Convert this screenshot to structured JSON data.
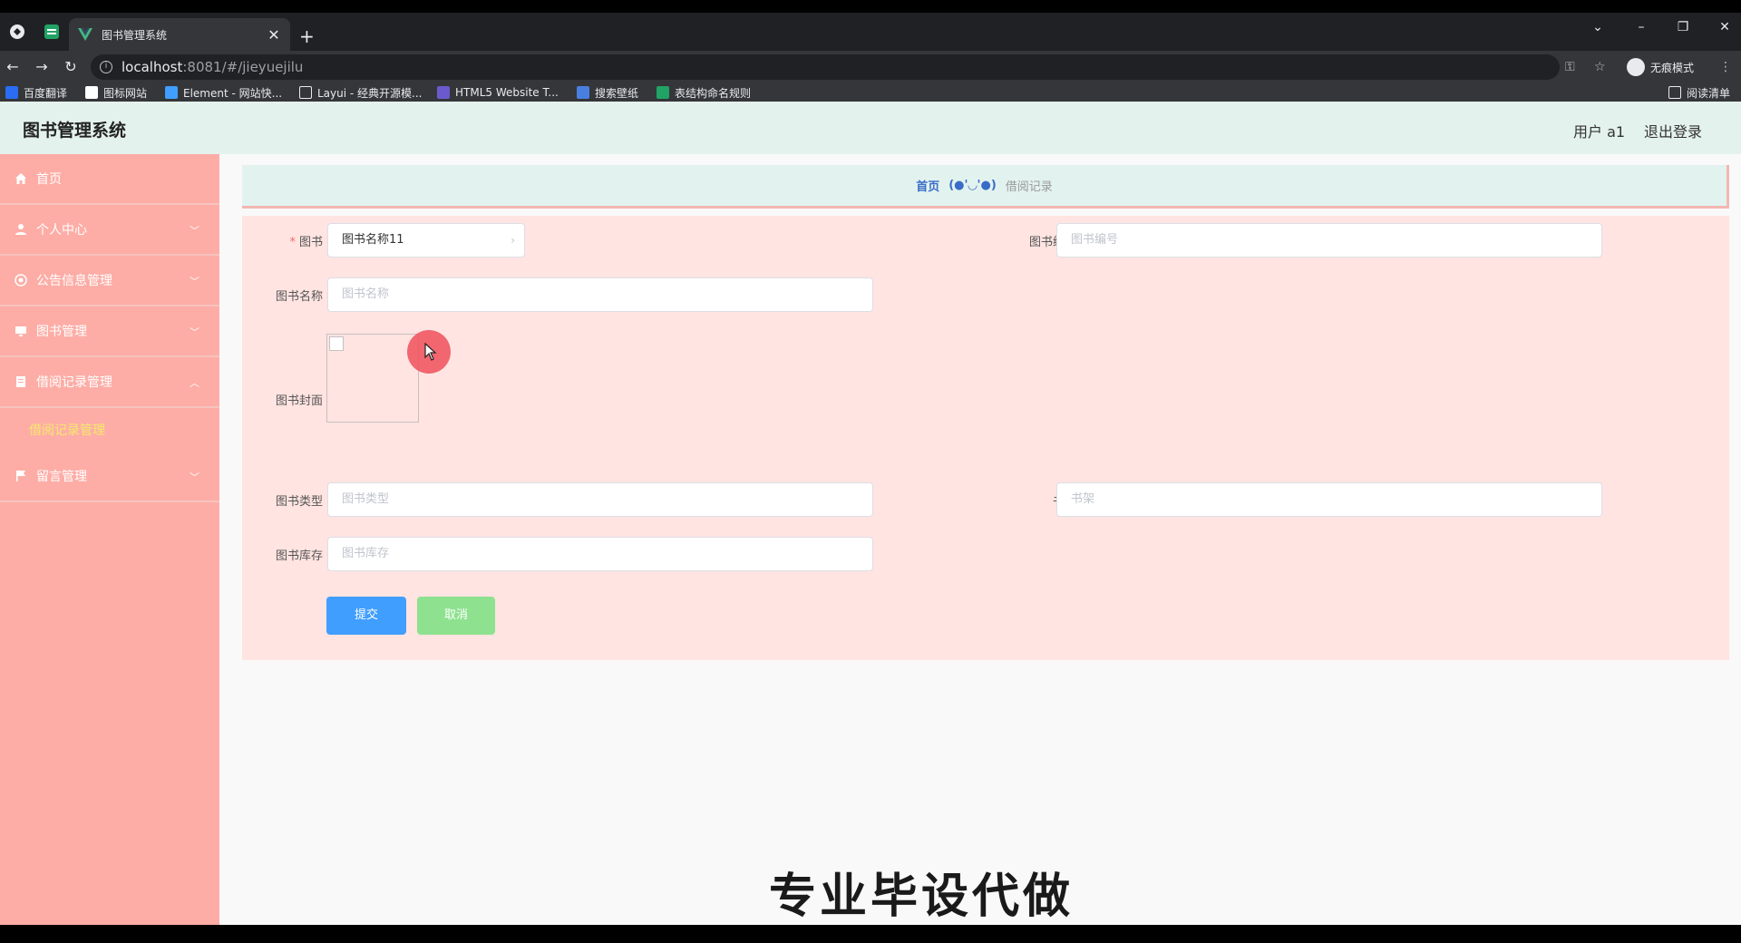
{
  "browser": {
    "tab_title": "图书管理系统",
    "new_tab": "+",
    "url_host": "localhost",
    "url_path": ":8081/#/jieyuejilu",
    "incognito_label": "无痕模式",
    "reading_list": "阅读清单",
    "bookmarks": [
      {
        "label": "百度翻译",
        "color": "#2a6df4"
      },
      {
        "label": "图标网站",
        "color": "#ffffff"
      },
      {
        "label": "Element - 网站快...",
        "color": "#409eff"
      },
      {
        "label": "Layui - 经典开源模...",
        "color": "#e8eaed"
      },
      {
        "label": "HTML5 Website T...",
        "color": "#6a5acd"
      },
      {
        "label": "搜索壁纸",
        "color": "#4a7fe0"
      },
      {
        "label": "表结构命名规则",
        "color": "#21a366"
      }
    ]
  },
  "header": {
    "title": "图书管理系统",
    "user": "用户 a1",
    "logout": "退出登录"
  },
  "sidebar": {
    "items": [
      {
        "label": "首页",
        "icon": "home-icon"
      },
      {
        "label": "个人中心",
        "icon": "user-icon"
      },
      {
        "label": "公告信息管理",
        "icon": "bell-icon"
      },
      {
        "label": "图书管理",
        "icon": "monitor-icon"
      },
      {
        "label": "借阅记录管理",
        "icon": "doc-icon"
      },
      {
        "label": "留言管理",
        "icon": "flag-icon"
      }
    ],
    "sub_item": "借阅记录管理"
  },
  "breadcrumb": {
    "home": "首页",
    "sep": "(●'◡'●)",
    "current": "借阅记录"
  },
  "form": {
    "book_label": "图书",
    "book_required": "*",
    "book_value": "图书名称11",
    "book_no_label": "图书编号",
    "book_no_placeholder": "图书编号",
    "book_name_label": "图书名称",
    "book_name_placeholder": "图书名称",
    "cover_label": "图书封面",
    "type_label": "图书类型",
    "type_placeholder": "图书类型",
    "shelf_label": "书架",
    "shelf_placeholder": "书架",
    "stock_label": "图书库存",
    "stock_placeholder": "图书库存",
    "submit": "提交",
    "cancel": "取消"
  },
  "watermark": "专业毕设代做",
  "colors": {
    "sidebar_bg": "#fdada6",
    "header_bg": "#e4f2ed",
    "form_bg": "#ffe4e1",
    "submit_btn": "#409eff",
    "cancel_btn": "#8ee28f",
    "submenu_active": "#f5e96b"
  }
}
